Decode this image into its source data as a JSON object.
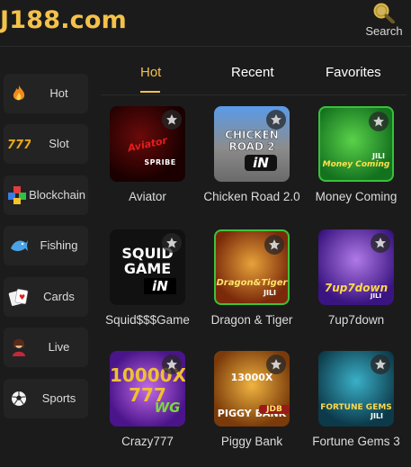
{
  "header": {
    "logo": "J188.com",
    "search_label": "Search"
  },
  "sidebar": {
    "items": [
      {
        "label": "Hot",
        "icon": "flame-icon"
      },
      {
        "label": "Slot",
        "icon": "slot-777-icon"
      },
      {
        "label": "Blockchain",
        "icon": "blockchain-cubes-icon"
      },
      {
        "label": "Fishing",
        "icon": "fish-icon"
      },
      {
        "label": "Cards",
        "icon": "cards-icon"
      },
      {
        "label": "Live",
        "icon": "live-dealer-icon"
      },
      {
        "label": "Sports",
        "icon": "soccer-ball-icon"
      }
    ]
  },
  "tabs": [
    {
      "label": "Hot",
      "active": true
    },
    {
      "label": "Recent",
      "active": false
    },
    {
      "label": "Favorites",
      "active": false
    }
  ],
  "games": [
    {
      "name": "Aviator",
      "art": "Aviator",
      "art2": "SPRIBE",
      "accent": "#c4121a"
    },
    {
      "name": "Chicken Road 2.0",
      "art": "CHICKEN ROAD 2",
      "art2": "iN",
      "accent": "#3f7fd6"
    },
    {
      "name": "Money Coming",
      "art": "Money Coming",
      "art2": "JILI",
      "accent": "#1f9a3a"
    },
    {
      "name": "Squid$$$Game",
      "art": "SQUID GAME",
      "art2": "iN",
      "accent": "#111111"
    },
    {
      "name": "Dragon & Tiger",
      "art": "Dragon&Tiger",
      "art2": "JILI",
      "accent": "#c45a12"
    },
    {
      "name": "7up7down",
      "art": "7up7down",
      "art2": "JILI",
      "accent": "#5a2bb0"
    },
    {
      "name": "Crazy777",
      "art": "10000X 777",
      "art2": "WG",
      "accent": "#7a2bd0"
    },
    {
      "name": "Piggy Bank",
      "art": "13000X PIGGY BANK",
      "art2": "JDB",
      "accent": "#c77a12"
    },
    {
      "name": "Fortune Gems 3",
      "art": "FORTUNE GEMS",
      "art2": "JILI",
      "accent": "#1f6e86"
    }
  ],
  "colors": {
    "brand": "#f4c14a",
    "background": "#1b1b1b",
    "sidebar_item": "#232323"
  }
}
